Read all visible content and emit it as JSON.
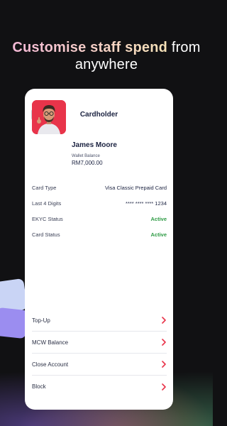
{
  "headline": {
    "accent": "Customise staff spend",
    "rest": "from anywhere"
  },
  "screen": {
    "title": "Cardholder",
    "back_icon": "chevron-left-icon"
  },
  "profile": {
    "name": "James Moore",
    "wallet_label": "Wallet Balance",
    "wallet_value": "RM7,000.00"
  },
  "details": [
    {
      "label": "Card Type",
      "value": "Visa Classic Prepaid Card",
      "status": false
    },
    {
      "label": "Last 4 Digits",
      "value": "**** **** **** 1234",
      "status": false
    },
    {
      "label": "EKYC Status",
      "value": "Active",
      "status": true
    },
    {
      "label": "Card Status",
      "value": "Active",
      "status": true
    }
  ],
  "actions": [
    {
      "label": "Top-Up"
    },
    {
      "label": "MCW Balance"
    },
    {
      "label": "Close Account"
    },
    {
      "label": "Block"
    }
  ],
  "colors": {
    "accent_red": "#e8344a",
    "active_green": "#2e9b45",
    "navy": "#1b2240"
  }
}
